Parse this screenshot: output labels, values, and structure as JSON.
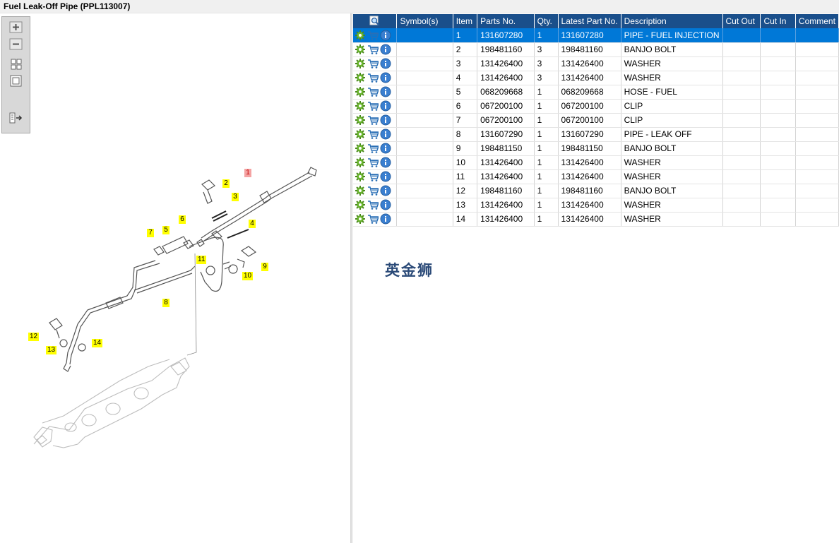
{
  "window": {
    "title": "Fuel Leak-Off Pipe (PPL113007)"
  },
  "toolbox": {
    "buttons": [
      {
        "name": "zoom-in-icon"
      },
      {
        "name": "zoom-out-icon"
      },
      {
        "name": "fit-window-icon"
      },
      {
        "name": "actual-size-icon"
      },
      {
        "name": "toggle-list-icon"
      }
    ]
  },
  "diagram": {
    "callouts": [
      "1",
      "2",
      "3",
      "4",
      "5",
      "6",
      "7",
      "8",
      "9",
      "10",
      "11",
      "12",
      "13",
      "14"
    ]
  },
  "table": {
    "headers": [
      "Symbol(s)",
      "Item",
      "Parts No.",
      "Qty.",
      "Latest Part No.",
      "Description",
      "Cut Out",
      "Cut In",
      "Comment"
    ],
    "rows": [
      {
        "item": "1",
        "parts_no": "131607280",
        "qty": "1",
        "latest": "131607280",
        "desc": "PIPE - FUEL INJECTION",
        "cut_out": "",
        "cut_in": "",
        "comment": ""
      },
      {
        "item": "2",
        "parts_no": "198481160",
        "qty": "3",
        "latest": "198481160",
        "desc": "BANJO BOLT",
        "cut_out": "",
        "cut_in": "",
        "comment": ""
      },
      {
        "item": "3",
        "parts_no": "131426400",
        "qty": "3",
        "latest": "131426400",
        "desc": "WASHER",
        "cut_out": "",
        "cut_in": "",
        "comment": ""
      },
      {
        "item": "4",
        "parts_no": "131426400",
        "qty": "3",
        "latest": "131426400",
        "desc": "WASHER",
        "cut_out": "",
        "cut_in": "",
        "comment": ""
      },
      {
        "item": "5",
        "parts_no": "068209668",
        "qty": "1",
        "latest": "068209668",
        "desc": "HOSE - FUEL",
        "cut_out": "",
        "cut_in": "",
        "comment": ""
      },
      {
        "item": "6",
        "parts_no": "067200100",
        "qty": "1",
        "latest": "067200100",
        "desc": "CLIP",
        "cut_out": "",
        "cut_in": "",
        "comment": ""
      },
      {
        "item": "7",
        "parts_no": "067200100",
        "qty": "1",
        "latest": "067200100",
        "desc": "CLIP",
        "cut_out": "",
        "cut_in": "",
        "comment": ""
      },
      {
        "item": "8",
        "parts_no": "131607290",
        "qty": "1",
        "latest": "131607290",
        "desc": "PIPE - LEAK OFF",
        "cut_out": "",
        "cut_in": "",
        "comment": ""
      },
      {
        "item": "9",
        "parts_no": "198481150",
        "qty": "1",
        "latest": "198481150",
        "desc": "BANJO BOLT",
        "cut_out": "",
        "cut_in": "",
        "comment": ""
      },
      {
        "item": "10",
        "parts_no": "131426400",
        "qty": "1",
        "latest": "131426400",
        "desc": "WASHER",
        "cut_out": "",
        "cut_in": "",
        "comment": ""
      },
      {
        "item": "11",
        "parts_no": "131426400",
        "qty": "1",
        "latest": "131426400",
        "desc": "WASHER",
        "cut_out": "",
        "cut_in": "",
        "comment": ""
      },
      {
        "item": "12",
        "parts_no": "198481160",
        "qty": "1",
        "latest": "198481160",
        "desc": "BANJO BOLT",
        "cut_out": "",
        "cut_in": "",
        "comment": ""
      },
      {
        "item": "13",
        "parts_no": "131426400",
        "qty": "1",
        "latest": "131426400",
        "desc": "WASHER",
        "cut_out": "",
        "cut_in": "",
        "comment": ""
      },
      {
        "item": "14",
        "parts_no": "131426400",
        "qty": "1",
        "latest": "131426400",
        "desc": "WASHER",
        "cut_out": "",
        "cut_in": "",
        "comment": ""
      }
    ],
    "selected_row": "1",
    "row_icons": [
      "gear-icon",
      "cart-icon",
      "info-icon"
    ]
  },
  "watermark": {
    "text": "英金狮"
  },
  "colors": {
    "header_bg": "#1a4f8b",
    "selected_row": "#0078d7",
    "callout_yellow": "#ffff00",
    "callout_red": "#f4a3a3"
  }
}
